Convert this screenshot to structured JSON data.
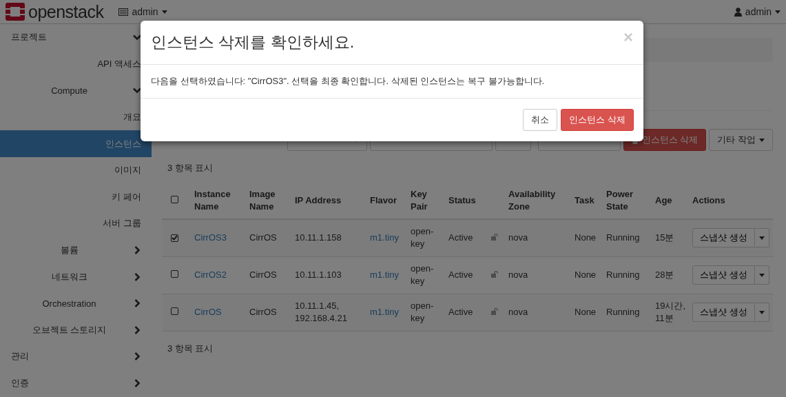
{
  "topbar": {
    "logo": "openstack",
    "project": "admin",
    "user": "admin"
  },
  "sidebar": {
    "items": [
      {
        "label": "프로젝트",
        "expanded": true,
        "children": [
          {
            "label": "API 액세스",
            "selected": false
          },
          {
            "label": "Compute",
            "expanded": true,
            "children": [
              {
                "label": "개요",
                "selected": false
              },
              {
                "label": "인스턴스",
                "selected": true
              },
              {
                "label": "이미지",
                "selected": false
              },
              {
                "label": "키 페어",
                "selected": false
              },
              {
                "label": "서버 그룹",
                "selected": false
              }
            ]
          },
          {
            "label": "볼륨",
            "expanded": false
          },
          {
            "label": "네트워크",
            "expanded": false
          },
          {
            "label": "Orchestration",
            "expanded": false
          },
          {
            "label": "오브젝트 스토리지",
            "expanded": false
          }
        ]
      },
      {
        "label": "관리",
        "expanded": false
      },
      {
        "label": "인증",
        "expanded": false
      }
    ]
  },
  "toolbar": {
    "delete_button": "인스턴스 삭제",
    "more_button": "기타 작업"
  },
  "table": {
    "count_top": "3 항목 표시",
    "select_all_checked": false,
    "count_bottom": "3 항목 표시",
    "columns": [
      "Instance Name",
      "Image Name",
      "IP Address",
      "Flavor",
      "Key Pair",
      "Status",
      "Availability Zone",
      "Task",
      "Power State",
      "Age",
      "Actions"
    ],
    "rows": [
      {
        "selected": true,
        "name": "CirrOS3",
        "image": "CirrOS",
        "ip": "10.11.1.158",
        "flavor": "m1.tiny",
        "key_pair": "open-key",
        "status": "Active",
        "zone": "nova",
        "task": "None",
        "power": "Running",
        "age": "15분",
        "action": "스냅샷 생성"
      },
      {
        "selected": false,
        "name": "CirrOS2",
        "image": "CirrOS",
        "ip": "10.11.1.103",
        "flavor": "m1.tiny",
        "key_pair": "open-key",
        "status": "Active",
        "zone": "nova",
        "task": "None",
        "power": "Running",
        "age": "28분",
        "action": "스냅샷 생성"
      },
      {
        "selected": false,
        "name": "CirrOS",
        "image": "CirrOS",
        "ip": "10.11.1.45, 192.168.4.21",
        "flavor": "m1.tiny",
        "key_pair": "open-key",
        "status": "Active",
        "zone": "nova",
        "task": "None",
        "power": "Running",
        "age": "19시간, 11분",
        "action": "스냅샷 생성"
      }
    ]
  },
  "modal": {
    "title": "인스턴스 삭제를 확인하세요.",
    "close": "×",
    "message": "다음을 선택하였습니다: \"CirrOS3\". 선택을 최종 확인합니다. 삭제된 인스턴스는 복구 불가능합니다.",
    "cancel": "취소",
    "confirm": "인스턴스 삭제"
  }
}
